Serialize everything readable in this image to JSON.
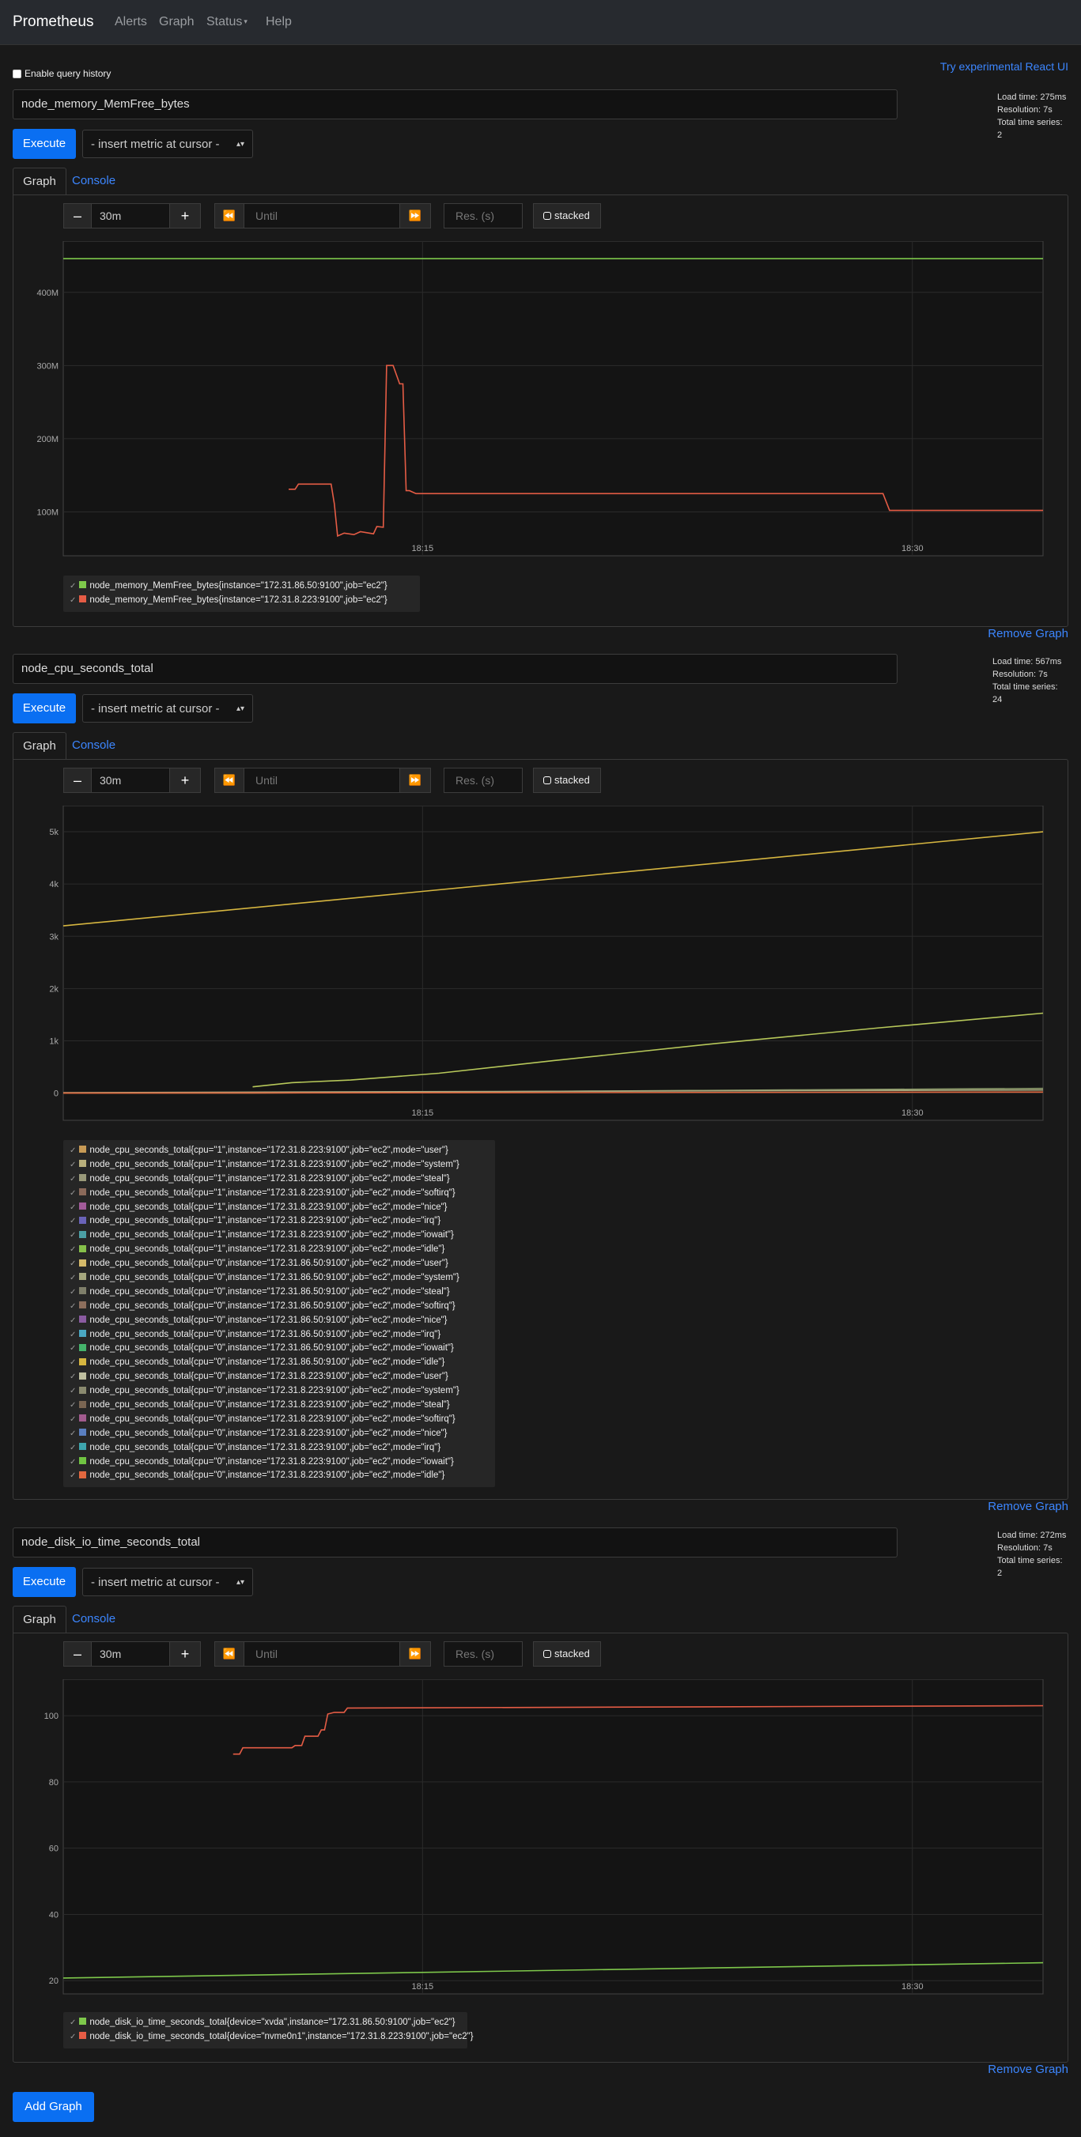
{
  "navbar": {
    "brand": "Prometheus",
    "links": [
      "Alerts",
      "Graph",
      "Status",
      "Help"
    ]
  },
  "top": {
    "history_label": "Enable query history",
    "react_link": "Try experimental React UI"
  },
  "panels": [
    {
      "expression": "node_memory_MemFree_bytes",
      "stats": {
        "load": "Load time: 275ms",
        "resolution": "Resolution: 7s",
        "series": "Total time series: 2"
      },
      "execute": "Execute",
      "insert": "- insert metric at cursor -",
      "tabs": {
        "graph": "Graph",
        "console": "Console"
      },
      "controls": {
        "minus": "–",
        "range": "30m",
        "plus": "+",
        "back": "⏪",
        "until_placeholder": "Until",
        "forward": "⏩",
        "res_placeholder": "Res. (s)",
        "stacked": "stacked"
      },
      "legend": [
        {
          "label": "node_memory_MemFree_bytes{instance=\"172.31.86.50:9100\",job=\"ec2\"}",
          "color": "#7ec84b"
        },
        {
          "label": "node_memory_MemFree_bytes{instance=\"172.31.8.223:9100\",job=\"ec2\"}",
          "color": "#e55c45"
        }
      ],
      "remove": "Remove Graph"
    },
    {
      "expression": "node_cpu_seconds_total",
      "stats": {
        "load": "Load time: 567ms",
        "resolution": "Resolution: 7s",
        "series": "Total time series: 24"
      },
      "execute": "Execute",
      "insert": "- insert metric at cursor -",
      "tabs": {
        "graph": "Graph",
        "console": "Console"
      },
      "controls": {
        "minus": "–",
        "range": "30m",
        "plus": "+",
        "back": "⏪",
        "until_placeholder": "Until",
        "forward": "⏩",
        "res_placeholder": "Res. (s)",
        "stacked": "stacked"
      },
      "legend": [
        {
          "label": "node_cpu_seconds_total{cpu=\"1\",instance=\"172.31.8.223:9100\",job=\"ec2\",mode=\"user\"}",
          "color": "#c79a55"
        },
        {
          "label": "node_cpu_seconds_total{cpu=\"1\",instance=\"172.31.8.223:9100\",job=\"ec2\",mode=\"system\"}",
          "color": "#b9b07c"
        },
        {
          "label": "node_cpu_seconds_total{cpu=\"1\",instance=\"172.31.8.223:9100\",job=\"ec2\",mode=\"steal\"}",
          "color": "#9a9a7a"
        },
        {
          "label": "node_cpu_seconds_total{cpu=\"1\",instance=\"172.31.8.223:9100\",job=\"ec2\",mode=\"softirq\"}",
          "color": "#8b6a5a"
        },
        {
          "label": "node_cpu_seconds_total{cpu=\"1\",instance=\"172.31.8.223:9100\",job=\"ec2\",mode=\"nice\"}",
          "color": "#a25b9a"
        },
        {
          "label": "node_cpu_seconds_total{cpu=\"1\",instance=\"172.31.8.223:9100\",job=\"ec2\",mode=\"irq\"}",
          "color": "#6a63b8"
        },
        {
          "label": "node_cpu_seconds_total{cpu=\"1\",instance=\"172.31.8.223:9100\",job=\"ec2\",mode=\"iowait\"}",
          "color": "#4b9fa5"
        },
        {
          "label": "node_cpu_seconds_total{cpu=\"1\",instance=\"172.31.8.223:9100\",job=\"ec2\",mode=\"idle\"}",
          "color": "#86c04a"
        },
        {
          "label": "node_cpu_seconds_total{cpu=\"0\",instance=\"172.31.86.50:9100\",job=\"ec2\",mode=\"user\"}",
          "color": "#d4b96a"
        },
        {
          "label": "node_cpu_seconds_total{cpu=\"0\",instance=\"172.31.86.50:9100\",job=\"ec2\",mode=\"system\"}",
          "color": "#a6a77e"
        },
        {
          "label": "node_cpu_seconds_total{cpu=\"0\",instance=\"172.31.86.50:9100\",job=\"ec2\",mode=\"steal\"}",
          "color": "#7f7f6a"
        },
        {
          "label": "node_cpu_seconds_total{cpu=\"0\",instance=\"172.31.86.50:9100\",job=\"ec2\",mode=\"softirq\"}",
          "color": "#8d6e5c"
        },
        {
          "label": "node_cpu_seconds_total{cpu=\"0\",instance=\"172.31.86.50:9100\",job=\"ec2\",mode=\"nice\"}",
          "color": "#8b5ba1"
        },
        {
          "label": "node_cpu_seconds_total{cpu=\"0\",instance=\"172.31.86.50:9100\",job=\"ec2\",mode=\"irq\"}",
          "color": "#4aa7c2"
        },
        {
          "label": "node_cpu_seconds_total{cpu=\"0\",instance=\"172.31.86.50:9100\",job=\"ec2\",mode=\"iowait\"}",
          "color": "#45b46c"
        },
        {
          "label": "node_cpu_seconds_total{cpu=\"0\",instance=\"172.31.86.50:9100\",job=\"ec2\",mode=\"idle\"}",
          "color": "#d6b640"
        },
        {
          "label": "node_cpu_seconds_total{cpu=\"0\",instance=\"172.31.8.223:9100\",job=\"ec2\",mode=\"user\"}",
          "color": "#bfbfa0"
        },
        {
          "label": "node_cpu_seconds_total{cpu=\"0\",instance=\"172.31.8.223:9100\",job=\"ec2\",mode=\"system\"}",
          "color": "#8a8a6f"
        },
        {
          "label": "node_cpu_seconds_total{cpu=\"0\",instance=\"172.31.8.223:9100\",job=\"ec2\",mode=\"steal\"}",
          "color": "#7a6552"
        },
        {
          "label": "node_cpu_seconds_total{cpu=\"0\",instance=\"172.31.8.223:9100\",job=\"ec2\",mode=\"softirq\"}",
          "color": "#a25b8e"
        },
        {
          "label": "node_cpu_seconds_total{cpu=\"0\",instance=\"172.31.8.223:9100\",job=\"ec2\",mode=\"nice\"}",
          "color": "#5a7fc0"
        },
        {
          "label": "node_cpu_seconds_total{cpu=\"0\",instance=\"172.31.8.223:9100\",job=\"ec2\",mode=\"irq\"}",
          "color": "#3ea5ad"
        },
        {
          "label": "node_cpu_seconds_total{cpu=\"0\",instance=\"172.31.8.223:9100\",job=\"ec2\",mode=\"iowait\"}",
          "color": "#70c442"
        },
        {
          "label": "node_cpu_seconds_total{cpu=\"0\",instance=\"172.31.8.223:9100\",job=\"ec2\",mode=\"idle\"}",
          "color": "#e2683f"
        }
      ],
      "remove": "Remove Graph"
    },
    {
      "expression": "node_disk_io_time_seconds_total",
      "stats": {
        "load": "Load time: 272ms",
        "resolution": "Resolution: 7s",
        "series": "Total time series: 2"
      },
      "execute": "Execute",
      "insert": "- insert metric at cursor -",
      "tabs": {
        "graph": "Graph",
        "console": "Console"
      },
      "controls": {
        "minus": "–",
        "range": "30m",
        "plus": "+",
        "back": "⏪",
        "until_placeholder": "Until",
        "forward": "⏩",
        "res_placeholder": "Res. (s)",
        "stacked": "stacked"
      },
      "legend": [
        {
          "label": "node_disk_io_time_seconds_total{device=\"xvda\",instance=\"172.31.86.50:9100\",job=\"ec2\"}",
          "color": "#7ec84b"
        },
        {
          "label": "node_disk_io_time_seconds_total{device=\"nvme0n1\",instance=\"172.31.8.223:9100\",job=\"ec2\"}",
          "color": "#e55c45"
        }
      ],
      "remove": "Remove Graph"
    }
  ],
  "add_graph": "Add Graph",
  "chart_data": [
    {
      "type": "line",
      "x_ticks": [
        "18:15",
        "18:30"
      ],
      "y_ticks": [
        "100M",
        "200M",
        "300M",
        "400M"
      ],
      "ylim": [
        40000000,
        470000000
      ],
      "xlim": [
        0,
        30
      ],
      "series": [
        {
          "name": "node_memory_MemFree_bytes{instance=\"172.31.86.50:9100\",job=\"ec2\"}",
          "color": "#7ec84b",
          "x": [
            0,
            30
          ],
          "y": [
            446000000,
            446000000
          ]
        },
        {
          "name": "node_memory_MemFree_bytes{instance=\"172.31.8.223:9100\",job=\"ec2\"}",
          "color": "#e55c45",
          "x": [
            6.9,
            7.1,
            7.2,
            8.2,
            8.3,
            8.4,
            8.6,
            8.9,
            9.1,
            9.5,
            9.6,
            9.8,
            9.9,
            10.1,
            10.3,
            10.4,
            10.5,
            10.6,
            10.8,
            25.1,
            25.3,
            30
          ],
          "y": [
            131000000,
            131000000,
            138000000,
            138000000,
            111000000,
            67000000,
            71000000,
            69000000,
            73000000,
            70000000,
            80000000,
            79000000,
            300000000,
            300000000,
            275000000,
            275000000,
            129000000,
            129000000,
            125000000,
            125000000,
            102000000,
            102000000
          ]
        }
      ]
    },
    {
      "type": "line",
      "x_ticks": [
        "18:15",
        "18:30"
      ],
      "y_ticks": [
        "0",
        "1k",
        "2k",
        "3k",
        "4k",
        "5k"
      ],
      "ylim": [
        -520,
        5500
      ],
      "xlim": [
        0,
        30
      ],
      "series": [
        {
          "name": "node_cpu_seconds_total{cpu=\"0\",instance=\"172.31.86.50:9100\",job=\"ec2\",mode=\"idle\"}",
          "color": "#d6b640",
          "x": [
            0,
            30
          ],
          "y": [
            3200,
            5000
          ]
        },
        {
          "name": "node_cpu_seconds_total{cpu=\"1\",instance=\"172.31.8.223:9100\",job=\"ec2\",mode=\"idle\"}",
          "color": "#b7c85a",
          "x": [
            5.8,
            7,
            8.8,
            11.5,
            15,
            20,
            25,
            30
          ],
          "y": [
            120,
            200,
            250,
            380,
            620,
            950,
            1250,
            1530
          ]
        },
        {
          "name": "node_cpu_seconds_total{cpu=\"0\",instance=\"172.31.8.223:9100\",job=\"ec2\",mode=\"user\"}",
          "color": "#8a9a6a",
          "x": [
            0,
            5.8,
            30
          ],
          "y": [
            0,
            0,
            90
          ]
        },
        {
          "name": "node_cpu_seconds_total{cpu=\"0\",instance=\"172.31.86.50:9100\",job=\"ec2\",mode=\"system\"}",
          "color": "#a6a77e",
          "x": [
            0,
            30
          ],
          "y": [
            10,
            60
          ]
        },
        {
          "name": "node_cpu_seconds_total{cpu=\"0\",instance=\"172.31.8.223:9100\",job=\"ec2\",mode=\"idle\"}",
          "color": "#e2683f",
          "x": [
            0,
            30
          ],
          "y": [
            0,
            20
          ]
        }
      ]
    },
    {
      "type": "line",
      "x_ticks": [
        "18:15",
        "18:30"
      ],
      "y_ticks": [
        "20",
        "40",
        "60",
        "80",
        "100"
      ],
      "ylim": [
        16,
        111
      ],
      "xlim": [
        0,
        30
      ],
      "series": [
        {
          "name": "node_disk_io_time_seconds_total{device=\"xvda\",instance=\"172.31.86.50:9100\",job=\"ec2\"}",
          "color": "#7ec84b",
          "x": [
            0,
            30
          ],
          "y": [
            20.8,
            25.4
          ]
        },
        {
          "name": "node_disk_io_time_seconds_total{device=\"nvme0n1\",instance=\"172.31.8.223:9100\",job=\"ec2\"}",
          "color": "#e55c45",
          "x": [
            5.2,
            5.4,
            5.5,
            7,
            7.1,
            7.3,
            7.4,
            7.8,
            7.9,
            8.0,
            8.1,
            8.3,
            8.6,
            8.7,
            8.8,
            30
          ],
          "y": [
            88.4,
            88.4,
            90.3,
            90.3,
            91,
            91,
            93.8,
            93.8,
            95.7,
            95.7,
            100.5,
            101,
            101,
            102.3,
            102.3,
            103
          ]
        }
      ]
    }
  ]
}
